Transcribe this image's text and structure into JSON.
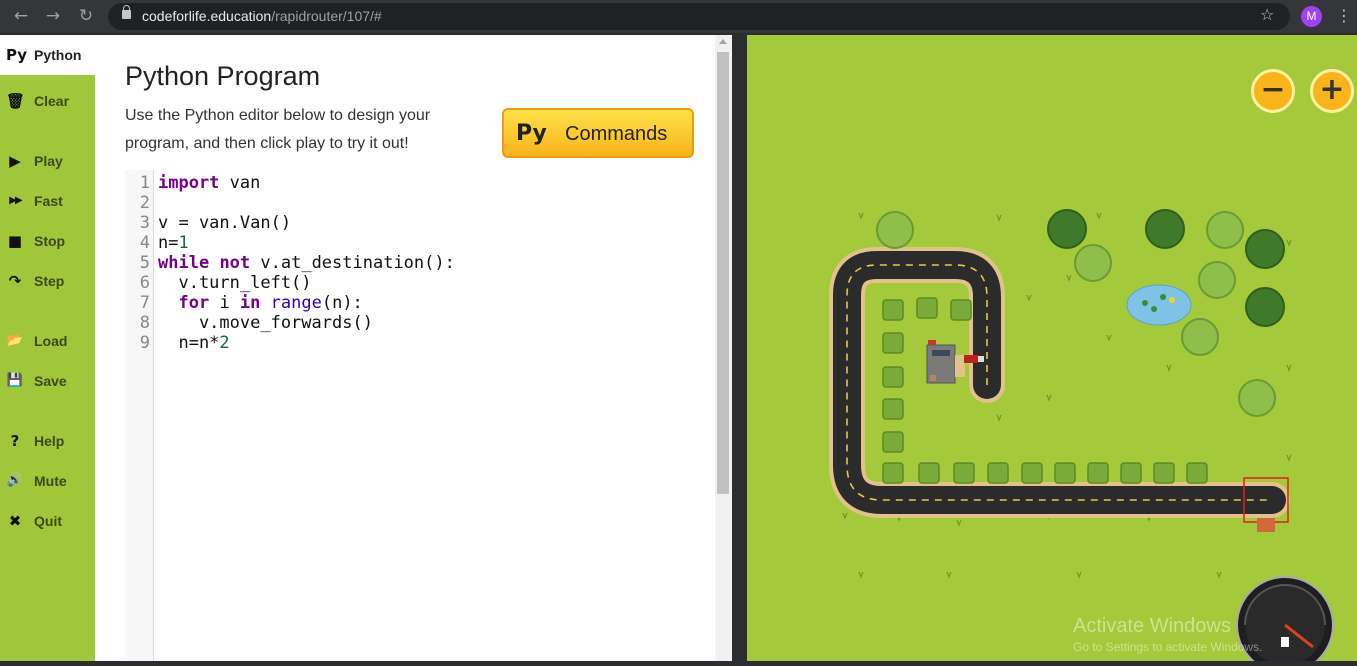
{
  "browser": {
    "url_host": "codeforlife.education",
    "url_path": "/rapidrouter/107/#",
    "avatar_initial": "M"
  },
  "sidebar": {
    "items": [
      {
        "icon": "Py",
        "label": "Python"
      },
      {
        "icon": "🗑",
        "label": "Clear"
      },
      {
        "icon": "▶",
        "label": "Play"
      },
      {
        "icon": "▶▶",
        "label": "Fast"
      },
      {
        "icon": "■",
        "label": "Stop"
      },
      {
        "icon": "↷",
        "label": "Step"
      },
      {
        "icon": "📂",
        "label": "Load"
      },
      {
        "icon": "💾",
        "label": "Save"
      },
      {
        "icon": "?",
        "label": "Help"
      },
      {
        "icon": "🔊",
        "label": "Mute"
      },
      {
        "icon": "✖",
        "label": "Quit"
      }
    ]
  },
  "editor": {
    "title": "Python Program",
    "description": "Use the Python editor below to design your program, and then click play to try it out!",
    "commands_button": {
      "icon": "Py",
      "label": "Commands"
    },
    "line_numbers": [
      "1",
      "2",
      "3",
      "4",
      "5",
      "6",
      "7",
      "8",
      "9"
    ],
    "code_lines": [
      "import van",
      "",
      "v = van.Van()",
      "n=1",
      "while not v.at_destination():",
      "  v.turn_left()",
      "  for i in range(n):",
      "    v.move_forwards()",
      "  n=n*2"
    ]
  },
  "map": {
    "zoom_out": "−",
    "zoom_in": "+",
    "watermark_title": "Activate Windows",
    "watermark_sub": "Go to Settings to activate Windows."
  }
}
